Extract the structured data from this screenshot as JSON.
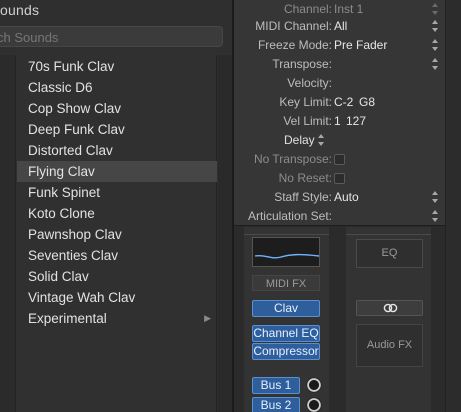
{
  "library": {
    "title": "ounds",
    "search_placeholder": "ch Sounds",
    "items": [
      {
        "label": "70s Funk Clav"
      },
      {
        "label": "Classic D6"
      },
      {
        "label": "Cop Show Clav"
      },
      {
        "label": "Deep Funk Clav"
      },
      {
        "label": "Distorted Clav"
      },
      {
        "label": "Flying Clav",
        "selected": true
      },
      {
        "label": "Funk Spinet"
      },
      {
        "label": "Koto Clone"
      },
      {
        "label": "Pawnshop Clav"
      },
      {
        "label": "Seventies Clav"
      },
      {
        "label": "Solid Clav"
      },
      {
        "label": "Vintage Wah Clav"
      },
      {
        "label": "Experimental",
        "has_submenu": true
      }
    ]
  },
  "inspector": {
    "channel": {
      "label": "Channel:",
      "value": "Inst 1"
    },
    "midi_channel": {
      "label": "MIDI Channel:",
      "value": "All"
    },
    "freeze_mode": {
      "label": "Freeze Mode:",
      "value": "Pre Fader"
    },
    "transpose": {
      "label": "Transpose:",
      "value": ""
    },
    "velocity": {
      "label": "Velocity:",
      "value": ""
    },
    "key_limit": {
      "label": "Key Limit:",
      "low": "C-2",
      "high": "G8"
    },
    "vel_limit": {
      "label": "Vel Limit:",
      "low": "1",
      "high": "127"
    },
    "delay": {
      "label": "Delay"
    },
    "no_transpose": {
      "label": "No Transpose:",
      "checked": false
    },
    "no_reset": {
      "label": "No Reset:",
      "checked": false
    },
    "staff_style": {
      "label": "Staff Style:",
      "value": "Auto"
    },
    "articulation_set": {
      "label": "Articulation Set:",
      "value": ""
    }
  },
  "strips": {
    "strip1": {
      "midi_fx": "MIDI FX",
      "instrument": "Clav",
      "plugins": [
        "Channel EQ",
        "Compressor"
      ],
      "sends": [
        "Bus 1",
        "Bus 2"
      ]
    },
    "strip2": {
      "eq": "EQ",
      "audio_fx": "Audio FX",
      "link_icon": "link-rings-icon"
    }
  },
  "colors": {
    "plugin_blue": "#2e5f9c",
    "selected_row": "#464646"
  }
}
